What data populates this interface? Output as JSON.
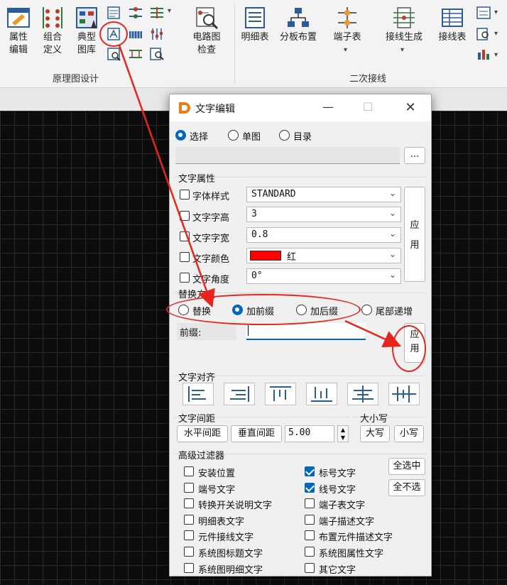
{
  "ribbon": {
    "buttons": [
      {
        "label1": "属性",
        "label2": "编辑"
      },
      {
        "label1": "组合",
        "label2": "定义"
      },
      {
        "label1": "典型",
        "label2": "图库"
      },
      {
        "label1": "电路图",
        "label2": "检查"
      },
      {
        "label1": "明细表",
        "label2": ""
      },
      {
        "label1": "分板布置",
        "label2": ""
      },
      {
        "label1": "端子表",
        "label2": ""
      },
      {
        "label1": "接线生成",
        "label2": ""
      },
      {
        "label1": "接线表",
        "label2": ""
      }
    ],
    "group1": "原理图设计",
    "group2": "二次接线"
  },
  "dialog": {
    "title": "文字编辑",
    "scope": {
      "options": [
        "选择",
        "单图",
        "目录"
      ],
      "selected": "选择",
      "browse": "..."
    },
    "props": {
      "title": "文字属性",
      "rows": [
        {
          "label": "字体样式",
          "value": "STANDARD"
        },
        {
          "label": "文字字高",
          "value": "3"
        },
        {
          "label": "文字字宽",
          "value": "0.8"
        },
        {
          "label": "文字颜色",
          "value": "红",
          "swatch": "#ff0000"
        },
        {
          "label": "文字角度",
          "value": "0°"
        }
      ],
      "apply": "应用"
    },
    "replace": {
      "title": "替换方式",
      "options": [
        "替换",
        "加前缀",
        "加后缀",
        "尾部递增"
      ],
      "selected": "加前缀",
      "prefix_label": "前缀:",
      "prefix_value": "",
      "apply": "应用"
    },
    "align": {
      "title": "文字对齐"
    },
    "spacing": {
      "title": "文字间距",
      "h": "水平间距",
      "v": "垂直间距",
      "value": "5.00"
    },
    "case": {
      "title": "大小写",
      "upper": "大写",
      "lower": "小写"
    },
    "filter": {
      "title": "高级过滤器",
      "select_all": "全选中",
      "select_none": "全不选",
      "left": [
        {
          "label": "安装位置",
          "checked": false
        },
        {
          "label": "端号文字",
          "checked": false
        },
        {
          "label": "转换开关说明文字",
          "checked": false
        },
        {
          "label": "明细表文字",
          "checked": false
        },
        {
          "label": "元件接线文字",
          "checked": false
        },
        {
          "label": "系统图标题文字",
          "checked": false
        },
        {
          "label": "系统图明细文字",
          "checked": false
        }
      ],
      "right": [
        {
          "label": "标号文字",
          "checked": true
        },
        {
          "label": "线号文字",
          "checked": true
        },
        {
          "label": "端子表文字",
          "checked": false
        },
        {
          "label": "端子描述文字",
          "checked": false
        },
        {
          "label": "布置元件描述文字",
          "checked": false
        },
        {
          "label": "系统图属性文字",
          "checked": false
        },
        {
          "label": "其它文字",
          "checked": false
        }
      ]
    }
  }
}
